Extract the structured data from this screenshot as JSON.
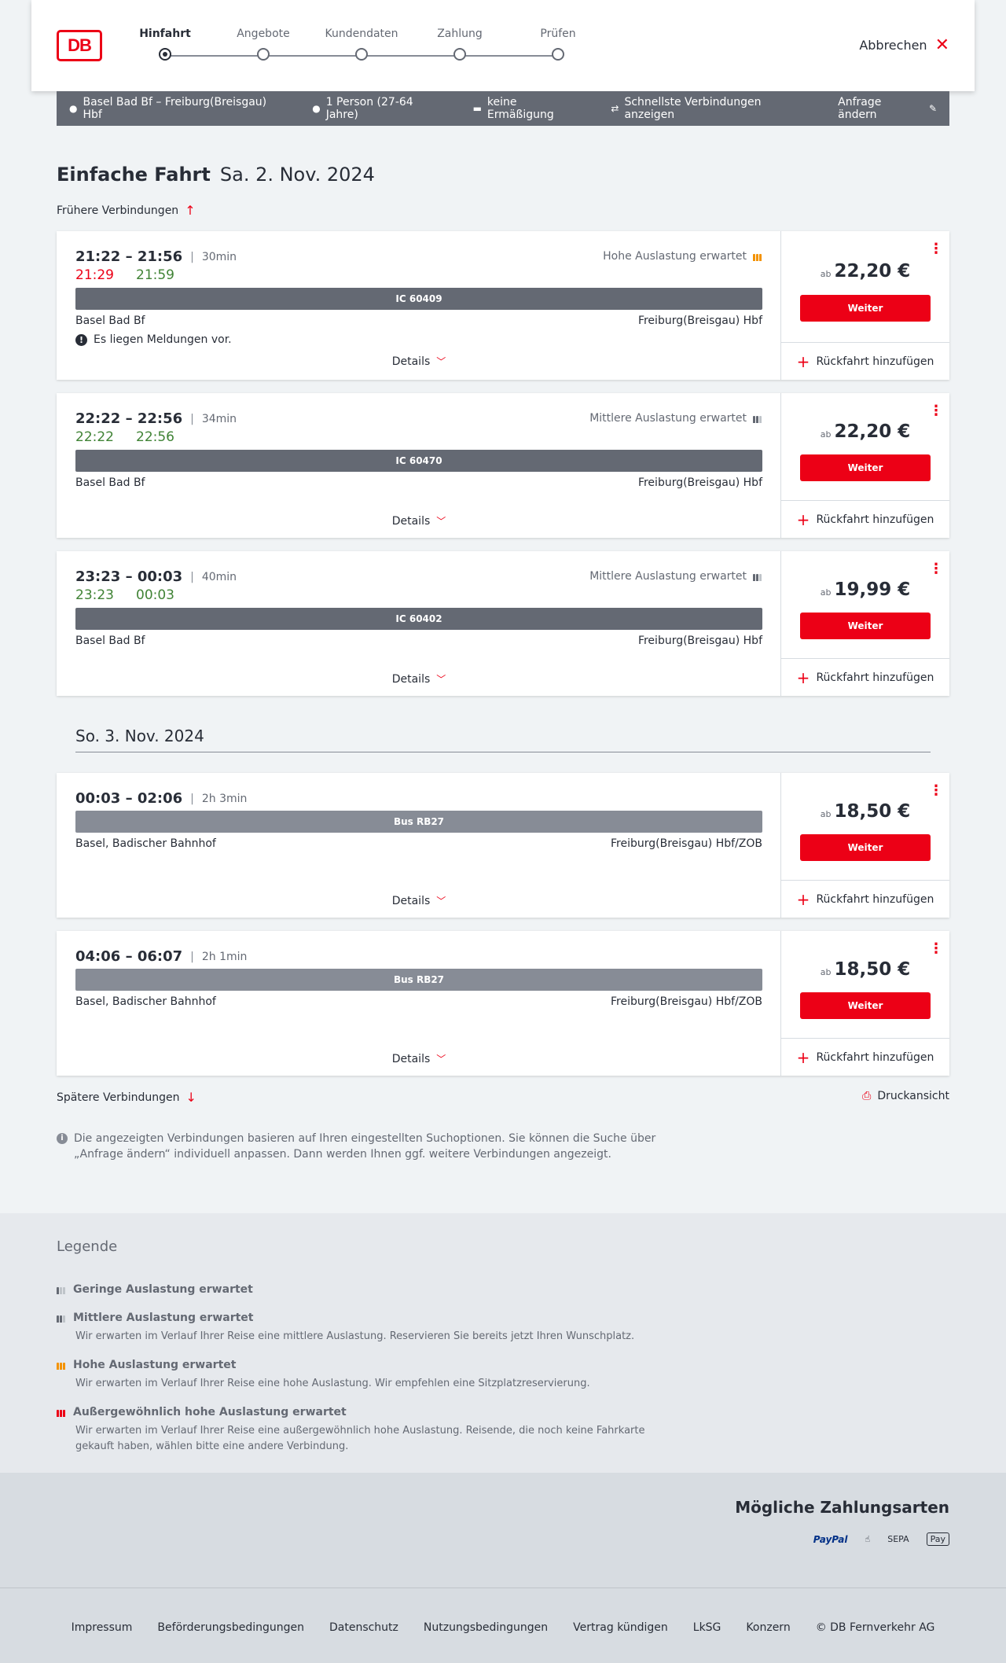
{
  "header": {
    "logo_text": "DB",
    "steps": [
      "Hinfahrt",
      "Angebote",
      "Kundendaten",
      "Zahlung",
      "Prüfen"
    ],
    "active_step": 0,
    "cancel_label": "Abbrechen"
  },
  "searchbar": {
    "route": "Basel Bad Bf – Freiburg(Breisgau) Hbf",
    "passengers": "1 Person (27-64 Jahre)",
    "discount": "keine Ermäßigung",
    "fastest": "Schnellste Verbindungen anzeigen",
    "change_request": "Anfrage ändern"
  },
  "title": {
    "main": "Einfache Fahrt",
    "date": "Sa. 2. Nov. 2024"
  },
  "earlier_label": "Frühere Verbindungen",
  "later_label": "Spätere Verbindungen",
  "print_label": "Druckansicht",
  "day2_label": "So. 3. Nov. 2024",
  "common": {
    "details": "Details",
    "weiter": "Weiter",
    "return": "Rückfahrt hinzufügen",
    "ab": "ab"
  },
  "connections": [
    {
      "time_range": "21:22 – 21:56",
      "duration": "30min",
      "rt_dep": "21:29",
      "rt_arr": "21:59",
      "rt_dep_late": true,
      "load": "Hohe Auslastung erwartet",
      "load_level": "high",
      "train": "IC 60409",
      "from": "Basel Bad Bf",
      "to": "Freiburg(Breisgau) Hbf",
      "notice": "Es liegen Meldungen vor.",
      "price": "22,20 €"
    },
    {
      "time_range": "22:22 – 22:56",
      "duration": "34min",
      "rt_dep": "22:22",
      "rt_arr": "22:56",
      "rt_dep_late": false,
      "load": "Mittlere Auslastung erwartet",
      "load_level": "med",
      "train": "IC 60470",
      "from": "Basel Bad Bf",
      "to": "Freiburg(Breisgau) Hbf",
      "price": "22,20 €"
    },
    {
      "time_range": "23:23 – 00:03",
      "duration": "40min",
      "rt_dep": "23:23",
      "rt_arr": "00:03",
      "rt_dep_late": false,
      "load": "Mittlere Auslastung erwartet",
      "load_level": "med",
      "train": "IC 60402",
      "from": "Basel Bad Bf",
      "to": "Freiburg(Breisgau) Hbf",
      "price": "19,99 €"
    },
    {
      "time_range": "00:03 – 02:06",
      "duration": "2h 3min",
      "train": "Bus RB27",
      "from": "Basel, Badischer Bahnhof",
      "to": "Freiburg(Breisgau) Hbf/ZOB",
      "price": "18,50 €"
    },
    {
      "time_range": "04:06 – 06:07",
      "duration": "2h 1min",
      "train": "Bus RB27",
      "from": "Basel, Badischer Bahnhof",
      "to": "Freiburg(Breisgau) Hbf/ZOB",
      "price": "18,50 €"
    }
  ],
  "info_note": "Die angezeigten Verbindungen basieren auf Ihren eingestellten Suchoptionen. Sie können die Suche über „Anfrage ändern“ individuell anpassen. Dann werden Ihnen ggf. weitere Verbindungen angezeigt.",
  "legend": {
    "title": "Legende",
    "items": [
      {
        "title": "Geringe Auslastung erwartet",
        "text": ""
      },
      {
        "title": "Mittlere Auslastung erwartet",
        "text": "Wir erwarten im Verlauf Ihrer Reise eine mittlere Auslastung. Reservieren Sie bereits jetzt Ihren Wunschplatz."
      },
      {
        "title": "Hohe Auslastung erwartet",
        "text": "Wir erwarten im Verlauf Ihrer Reise eine hohe Auslastung. Wir empfehlen eine Sitzplatzreservierung."
      },
      {
        "title": "Außergewöhnlich hohe Auslastung erwartet",
        "text": "Wir erwarten im Verlauf Ihrer Reise eine außergewöhnlich hohe Auslastung. Reisende, die noch keine Fahrkarte gekauft haben, wählen bitte eine andere Verbindung."
      }
    ]
  },
  "payment": {
    "title": "Mögliche Zahlungsarten",
    "methods": [
      "PayPal",
      "SEPA",
      "Pay"
    ]
  },
  "footer": {
    "links": [
      "Impressum",
      "Beförderungsbedingungen",
      "Datenschutz",
      "Nutzungsbedingungen",
      "Vertrag kündigen",
      "LkSG",
      "Konzern",
      "© DB Fernverkehr AG"
    ]
  },
  "colors": {
    "brand_red": "#ec0016",
    "on_time_green": "#408335",
    "high_load_orange": "#f39200",
    "bar_grey": "#646973"
  }
}
